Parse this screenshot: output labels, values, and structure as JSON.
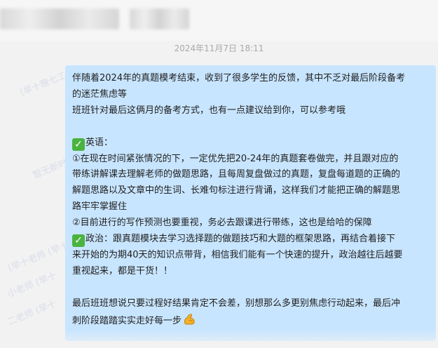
{
  "timestamp": "2024年11月7日 18:11",
  "message": {
    "line1": "伴随着2024年的真题模考结束，收到了很多学生的反馈，其中不乏对最后阶段备考",
    "line2": "的迷茫焦虑等",
    "line3": "班班针对最后这俩月的备考方式，也有一点建议给到你，可以参考哦",
    "english_heading": "英语：",
    "english_1a": "①在现在时间紧张情况的下，一定优先把20-24年的真题套卷做完，并且跟对应的",
    "english_1b": "带练讲解课去理解老师的做题思路，且每周复盘做过的真题，复盘每道题的正确的",
    "english_1c": "解题思路以及文章中的生词、长难句标注进行背诵，这样我们才能把正确的解题思",
    "english_1d": "路牢牢掌握住",
    "english_2": "②目前进行的写作预测也要重视，务必去跟课进行带练，这也是给哈的保障",
    "politics_a": "政治：跟真题模块去学习选择题的做题技巧和大题的框架思路，再结合着接下",
    "politics_b": "来开始的为期40天的知识点带背，相信我们能有一个快速的提升，政治越往后越要",
    "politics_c": "重视起来，都是干货！！",
    "closing_a": "最后班班想说只要过程好结果肯定不会差，别想那么多更别焦虑行动起来，最后冲",
    "closing_b": "刺阶段踏踏实实走好每一步"
  },
  "icons": {
    "check": "white-heavy-check-mark-icon",
    "muscle": "flexed-biceps-icon"
  },
  "colors": {
    "bubble": "#c8e5ff",
    "check": "#4ab340",
    "background": "#f2f2f3"
  }
}
